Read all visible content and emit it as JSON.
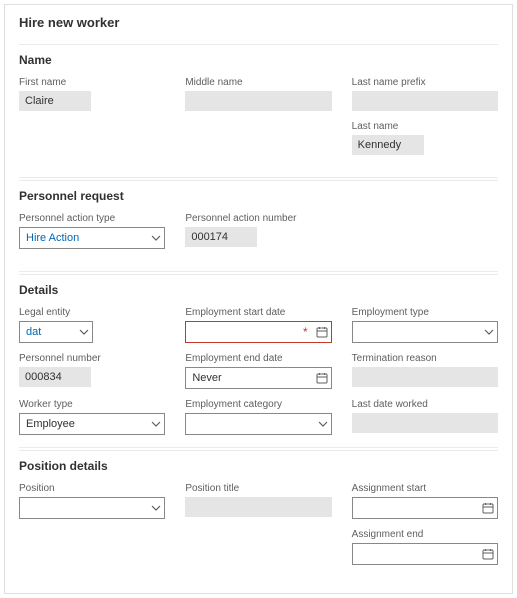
{
  "pageTitle": "Hire new worker",
  "sections": {
    "name": {
      "title": "Name",
      "firstNameLabel": "First name",
      "firstName": "Claire",
      "middleNameLabel": "Middle name",
      "middleName": "",
      "lastNamePrefixLabel": "Last name prefix",
      "lastNamePrefix": "",
      "lastNameLabel": "Last name",
      "lastName": "Kennedy"
    },
    "personnel": {
      "title": "Personnel request",
      "actionTypeLabel": "Personnel action type",
      "actionType": "Hire Action",
      "actionNumberLabel": "Personnel action number",
      "actionNumber": "000174"
    },
    "details": {
      "title": "Details",
      "legalEntityLabel": "Legal entity",
      "legalEntity": "dat",
      "personnelNumberLabel": "Personnel number",
      "personnelNumber": "000834",
      "workerTypeLabel": "Worker type",
      "workerType": "Employee",
      "employmentStartLabel": "Employment start date",
      "employmentStart": "",
      "employmentEndLabel": "Employment end date",
      "employmentEnd": "Never",
      "employmentCategoryLabel": "Employment category",
      "employmentCategory": "",
      "employmentTypeLabel": "Employment type",
      "employmentType": "",
      "terminationReasonLabel": "Termination reason",
      "terminationReason": "",
      "lastDateWorkedLabel": "Last date worked",
      "lastDateWorked": ""
    },
    "position": {
      "title": "Position details",
      "positionLabel": "Position",
      "position": "",
      "positionTitleLabel": "Position title",
      "positionTitle": "",
      "assignmentStartLabel": "Assignment start",
      "assignmentStart": "",
      "assignmentEndLabel": "Assignment end",
      "assignmentEnd": ""
    }
  }
}
